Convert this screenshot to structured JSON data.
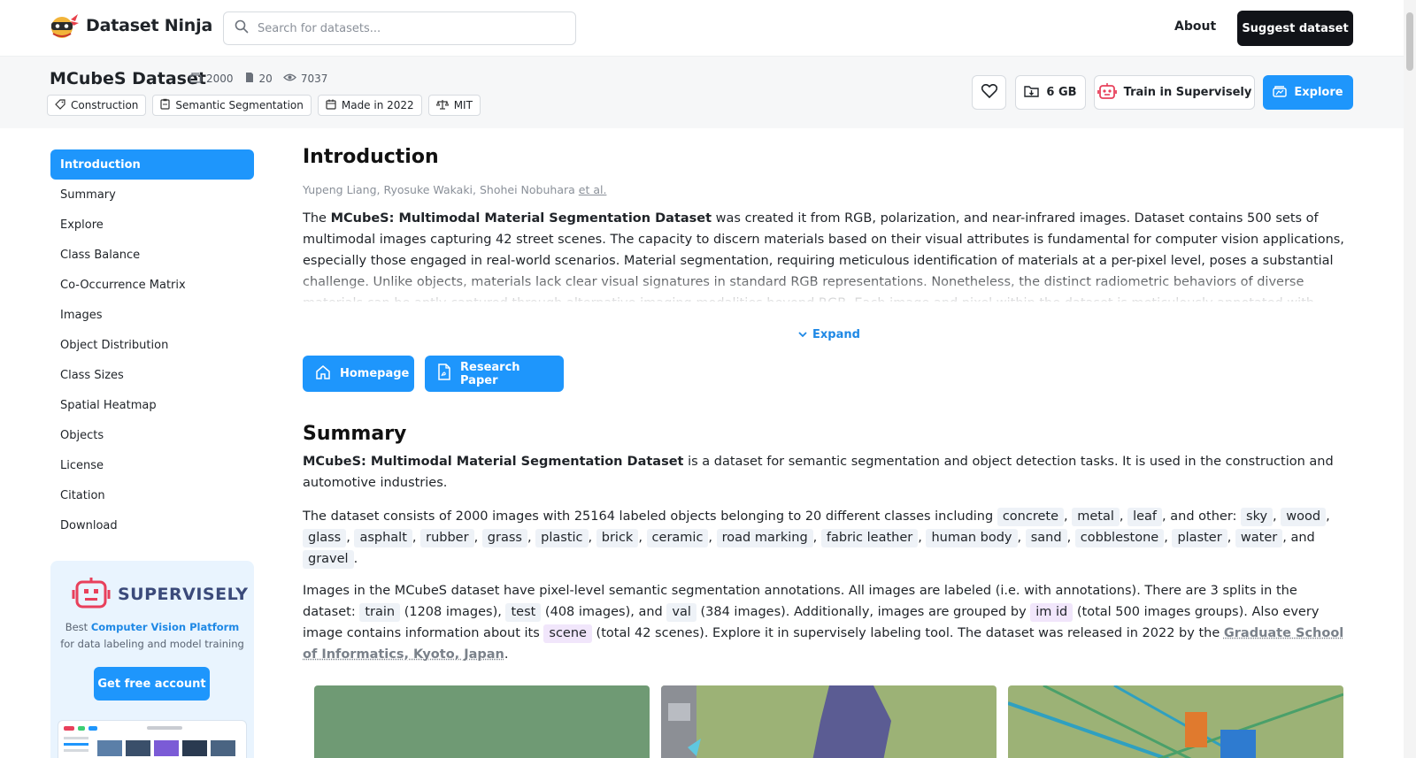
{
  "nav": {
    "logo_text": "Dataset Ninja",
    "search_placeholder": "Search for datasets...",
    "about_label": "About",
    "suggest_label": "Suggest dataset"
  },
  "dataset": {
    "title": "MCubeS Dataset",
    "stats": [
      {
        "icon": "images-icon",
        "value": "2000"
      },
      {
        "icon": "classes-icon",
        "value": "20"
      },
      {
        "icon": "views-icon",
        "value": "7037"
      }
    ],
    "tags": [
      {
        "icon": "tag-icon",
        "label": "Construction"
      },
      {
        "icon": "clipboard-icon",
        "label": "Semantic Segmentation"
      },
      {
        "icon": "calendar-icon",
        "label": "Made in 2022"
      },
      {
        "icon": "scales-icon",
        "label": "MIT"
      }
    ],
    "size_label": "6 GB",
    "train_label": "Train in Supervisely",
    "explore_label": "Explore"
  },
  "sidebar": {
    "items": [
      {
        "label": "Introduction",
        "active": true
      },
      {
        "label": "Summary"
      },
      {
        "label": "Explore"
      },
      {
        "label": "Class Balance"
      },
      {
        "label": "Co-Occurrence Matrix"
      },
      {
        "label": "Images"
      },
      {
        "label": "Object Distribution"
      },
      {
        "label": "Class Sizes"
      },
      {
        "label": "Spatial Heatmap"
      },
      {
        "label": "Objects"
      },
      {
        "label": "License"
      },
      {
        "label": "Citation"
      },
      {
        "label": "Download"
      }
    ],
    "promo": {
      "brand": "SUPERVISELY",
      "text_prefix": "Best ",
      "text_link": "Computer Vision Platform",
      "text_suffix": " for data labeling and model training",
      "button": "Get free account"
    }
  },
  "intro": {
    "heading": "Introduction",
    "authors": "Yupeng Liang, Ryosuke Wakaki, Shohei Nobuhara ",
    "authors_more": "et al.",
    "text_prefix": "The ",
    "text_bold": "MCubeS: Multimodal Material Segmentation Dataset",
    "text_rest": " was created it from RGB, polarization, and near-infrared images. Dataset contains 500 sets of multimodal images capturing 42 street scenes. The capacity to discern materials based on their visual attributes is fundamental for computer vision applications, especially those engaged in real-world scenarios. Material segmentation, requiring meticulous identification of materials at a per-pixel level, poses a substantial challenge. Unlike objects, materials lack clear visual signatures in standard RGB representations. Nonetheless, the distinct radiometric behaviors of diverse materials can be aptly captured through alternative imaging modalities beyond RGB. Each image and pixel within the dataset is meticulously annotated with ground truth",
    "expand_label": "Expand",
    "homepage_label": "Homepage",
    "paper_label": "Research Paper"
  },
  "summary": {
    "heading": "Summary",
    "p1_bold": "MCubeS: Multimodal Material Segmentation Dataset",
    "p1_rest": " is a dataset for semantic segmentation and object detection tasks. It is used in the construction and automotive industries.",
    "p2_prefix": "The dataset consists of 2000 images with 25164 labeled objects belonging to 20 different classes including ",
    "top_classes": [
      "concrete",
      "metal",
      "leaf"
    ],
    "p2_other": ", and other: ",
    "other_classes": [
      "sky",
      "wood",
      "glass",
      "asphalt",
      "rubber",
      "grass",
      "plastic",
      "brick",
      "ceramic",
      "road marking",
      "fabric leather",
      "human body",
      "sand",
      "cobblestone",
      "plaster",
      "water"
    ],
    "p2_and": ", and ",
    "last_class": "gravel",
    "p3_a": "Images in the MCubeS dataset have pixel-level semantic segmentation annotations. All images are labeled (i.e. with annotations). There are 3 splits in the dataset: ",
    "split_train": "train",
    "p3_b": " (1208 images), ",
    "split_test": "test",
    "p3_c": " (408 images), and ",
    "split_val": "val",
    "p3_d": " (384 images). Additionally, images are grouped by ",
    "tag_imid": "im id",
    "p3_e": " (total 500 images groups). Also every image contains information about its ",
    "tag_scene": "scene",
    "p3_f": " (total 42 scenes). Explore it in supervisely labeling tool. The dataset was released in 2022 by the ",
    "org_link": "Graduate School of Informatics, Kyoto, Japan",
    "p3_g": "."
  },
  "colors": {
    "accent": "#1e96fc",
    "dark_button": "#111318",
    "chip_bg": "#eef2f7",
    "chip_purple_bg": "#f1e6fb"
  }
}
